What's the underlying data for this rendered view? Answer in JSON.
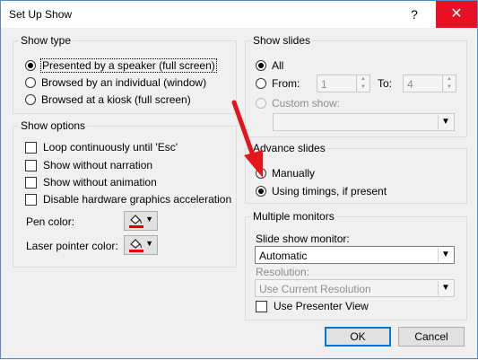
{
  "window": {
    "title": "Set Up Show",
    "help_glyph": "?",
    "close_glyph": "✕"
  },
  "show_type": {
    "legend": "Show type",
    "options": [
      {
        "label": "Presented by a speaker (full screen)",
        "checked": true
      },
      {
        "label": "Browsed by an individual (window)",
        "checked": false
      },
      {
        "label": "Browsed at a kiosk (full screen)",
        "checked": false
      }
    ]
  },
  "show_options": {
    "legend": "Show options",
    "checkboxes": [
      {
        "label": "Loop continuously until 'Esc'",
        "checked": false
      },
      {
        "label": "Show without narration",
        "checked": false
      },
      {
        "label": "Show without animation",
        "checked": false
      },
      {
        "label": "Disable hardware graphics acceleration",
        "checked": false
      }
    ],
    "pen_color_label": "Pen color:",
    "laser_color_label": "Laser pointer color:",
    "pen_color": "#e00000",
    "laser_color": "#e00000"
  },
  "show_slides": {
    "legend": "Show slides",
    "all_label": "All",
    "from_label": "From:",
    "from_value": "1",
    "to_label": "To:",
    "to_value": "4",
    "custom_label": "Custom show:",
    "selected": "All"
  },
  "advance_slides": {
    "legend": "Advance slides",
    "options": [
      {
        "label": "Manually",
        "checked": false
      },
      {
        "label": "Using timings, if present",
        "checked": true
      }
    ]
  },
  "multiple_monitors": {
    "legend": "Multiple monitors",
    "monitor_label": "Slide show monitor:",
    "monitor_value": "Automatic",
    "resolution_label": "Resolution:",
    "resolution_value": "Use Current Resolution",
    "presenter_view_label": "Use Presenter View",
    "presenter_view_checked": false
  },
  "buttons": {
    "ok": "OK",
    "cancel": "Cancel"
  },
  "colors": {
    "accent": "#0078d7",
    "close": "#e81123",
    "annotation_arrow": "#e8141b"
  },
  "icons": {
    "dropdown": "▼",
    "spin_up": "▲",
    "spin_down": "▼"
  }
}
